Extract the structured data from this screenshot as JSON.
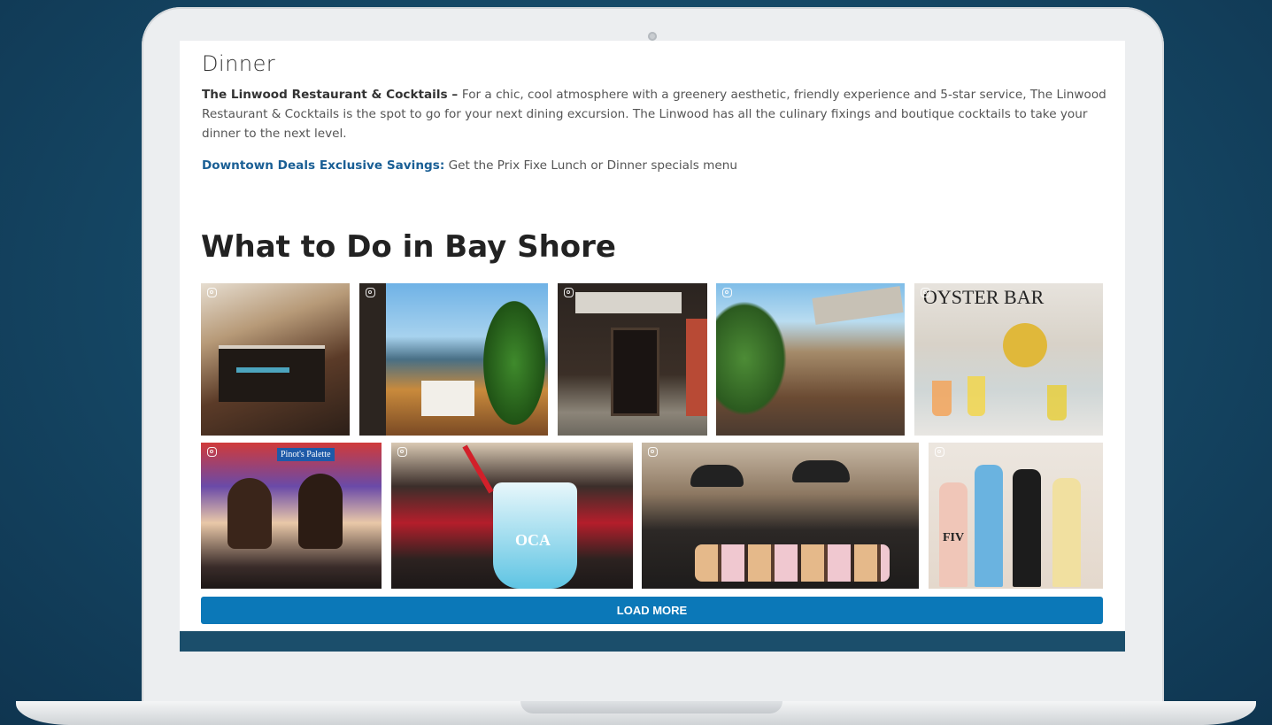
{
  "dinner": {
    "heading": "Dinner",
    "restaurant_name": "The Linwood Restaurant & Cocktails – ",
    "description": "For a chic, cool atmosphere with a greenery aesthetic, friendly experience and 5-star service, The Linwood Restaurant & Cocktails is the spot to go for your next dining excursion. The Linwood has all the culinary fixings and boutique cocktails to take your dinner to the next level.",
    "deals_label": "Downtown Deals Exclusive Savings:",
    "deals_text": " Get the Prix Fixe Lunch or Dinner specials menu"
  },
  "section": {
    "title": "What to Do in Bay Shore"
  },
  "instagram_feed": {
    "icon": "instagram-icon",
    "tiles": [
      {
        "name": "bar-interior-photo"
      },
      {
        "name": "waterfront-dining-photo"
      },
      {
        "name": "boutique-storefront-photo"
      },
      {
        "name": "outdoor-patio-photo"
      },
      {
        "name": "oyster-bar-cocktails-photo",
        "caption": "OYSTER BAR"
      },
      {
        "name": "pinot-picasso-painting-photo",
        "caption": "Pinot's Palette"
      },
      {
        "name": "milkshake-photo",
        "caption": "OCA"
      },
      {
        "name": "donut-tray-photo"
      },
      {
        "name": "wine-bottles-photo",
        "caption": "FIV"
      }
    ],
    "load_more_label": "LOAD MORE"
  },
  "colors": {
    "link_blue": "#1a5f95",
    "button_blue": "#0b78b8",
    "background": "#164a68"
  }
}
